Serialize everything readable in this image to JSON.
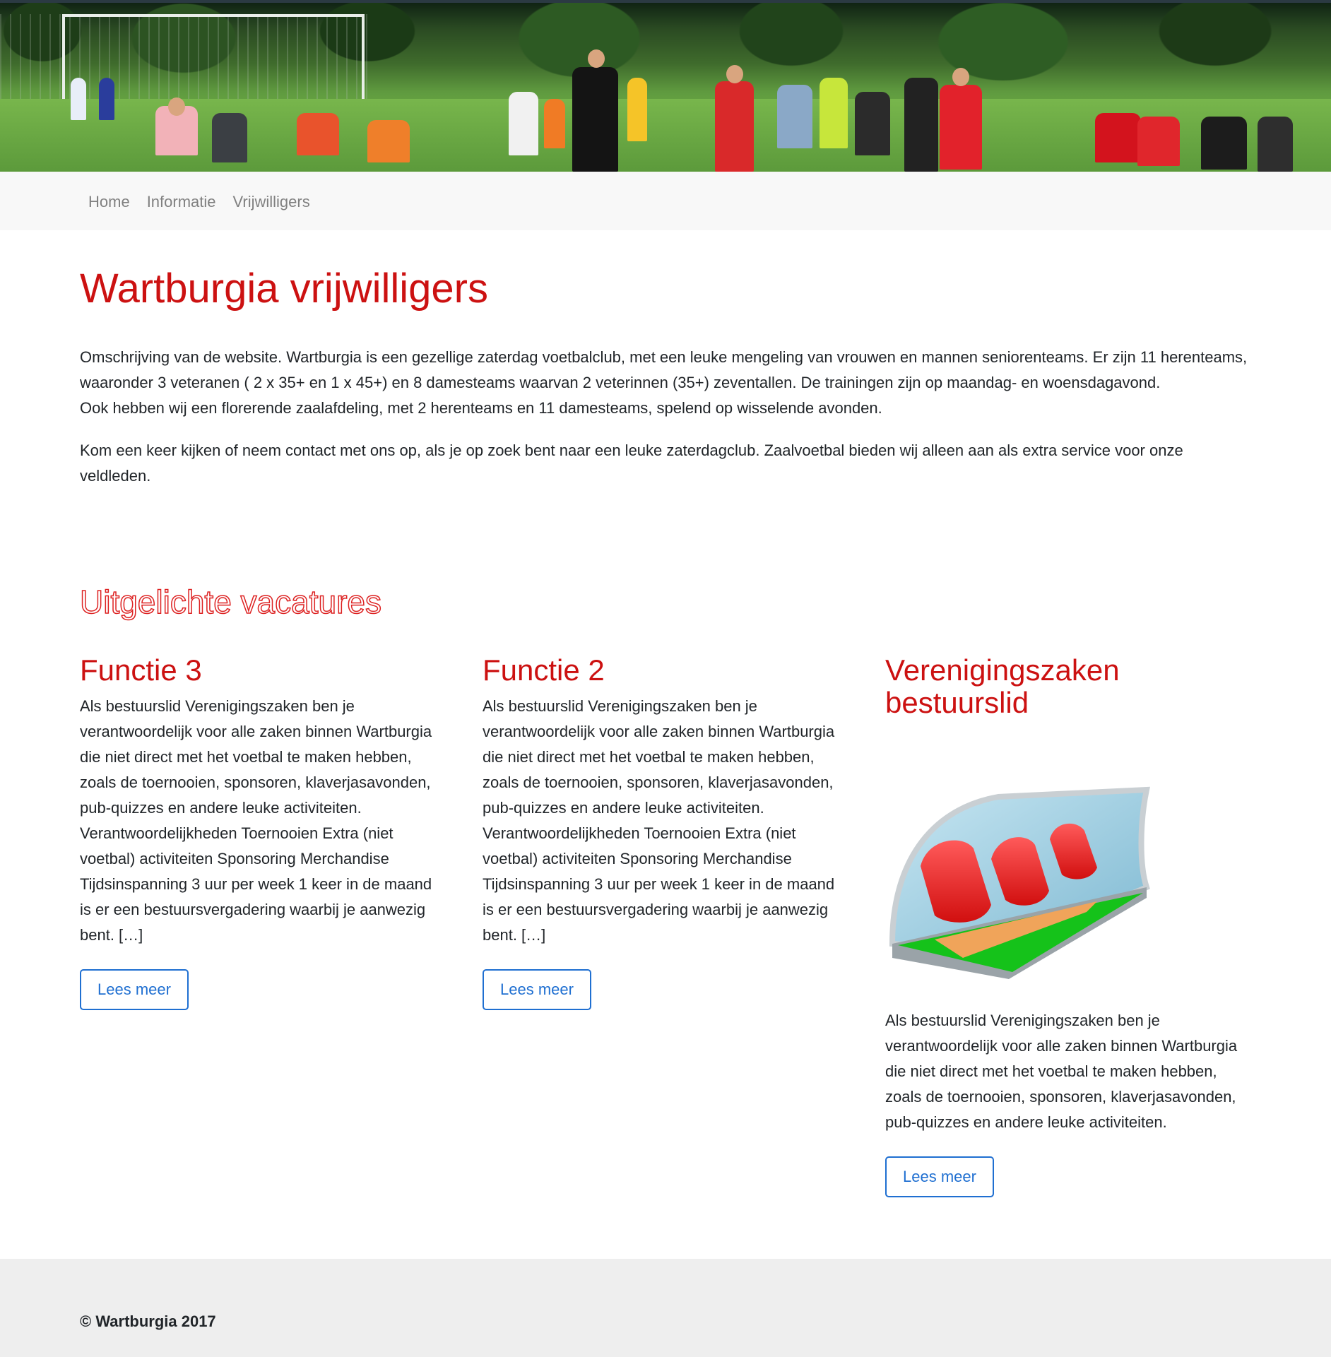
{
  "hero": {
    "image": "football-field-photo"
  },
  "nav": {
    "items": [
      {
        "label": "Home"
      },
      {
        "label": "Informatie"
      },
      {
        "label": "Vrijwilligers"
      }
    ]
  },
  "main": {
    "title": "Wartburgia vrijwilligers",
    "intro": {
      "p1": "Omschrijving van de website. Wartburgia is een gezellige zaterdag voetbalclub, met een leuke mengeling van vrouwen en mannen seniorenteams. Er zijn 11 herenteams, waaronder 3 veteranen ( 2 x 35+ en 1 x 45+) en 8 damesteams waarvan 2 veterinnen (35+) zeventallen. De trainingen zijn op maandag- en woensdagavond.",
      "p1b": "Ook hebben wij een florerende zaalafdeling, met 2 herenteams en 11 damesteams, spelend op wisselende avonden.",
      "p2": "Kom een keer kijken of neem contact met ons op, als je op zoek bent naar een leuke zaterdagclub. Zaalvoetbal bieden wij alleen aan als extra service voor onze veldleden."
    },
    "section_title": "Uitgelichte vacatures",
    "cards": [
      {
        "title": "Functie 3",
        "text": "Als bestuurslid Verenigingszaken ben je verantwoordelijk voor alle zaken binnen Wartburgia die niet direct met het voetbal te maken hebben, zoals de toernooien, sponsoren, klaverjasavonden, pub-quizzes en andere leuke activiteiten. Verantwoordelijkheden Toernooien Extra (niet voetbal) activiteiten Sponsoring Merchandise Tijdsinspanning 3 uur per week 1 keer in de maand is er een bestuursvergadering waarbij je aanwezig bent. […]",
        "button": "Lees meer"
      },
      {
        "title": "Functie 2",
        "text": "Als bestuurslid Verenigingszaken ben je verantwoordelijk voor alle zaken binnen Wartburgia die niet direct met het voetbal te maken hebben, zoals de toernooien, sponsoren, klaverjasavonden, pub-quizzes en andere leuke activiteiten. Verantwoordelijkheden Toernooien Extra (niet voetbal) activiteiten Sponsoring Merchandise Tijdsinspanning 3 uur per week 1 keer in de maand is er een bestuursvergadering waarbij je aanwezig bent. […]",
        "button": "Lees meer"
      },
      {
        "title": "Verenigingszaken bestuurslid",
        "image": "dugout-bench-icon",
        "text": "Als bestuurslid Verenigingszaken ben je verantwoordelijk voor alle zaken binnen Wartburgia die niet direct met het voetbal te maken hebben, zoals de toernooien, sponsoren, klaverjasavonden, pub-quizzes en andere leuke activiteiten.",
        "button": "Lees meer"
      }
    ]
  },
  "footer": {
    "copyright": "© Wartburgia 2017"
  },
  "colors": {
    "accent": "#cc1111",
    "link": "#1f6fd1",
    "nav_bg": "#f8f8f8",
    "footer_bg": "#eeeeee"
  }
}
